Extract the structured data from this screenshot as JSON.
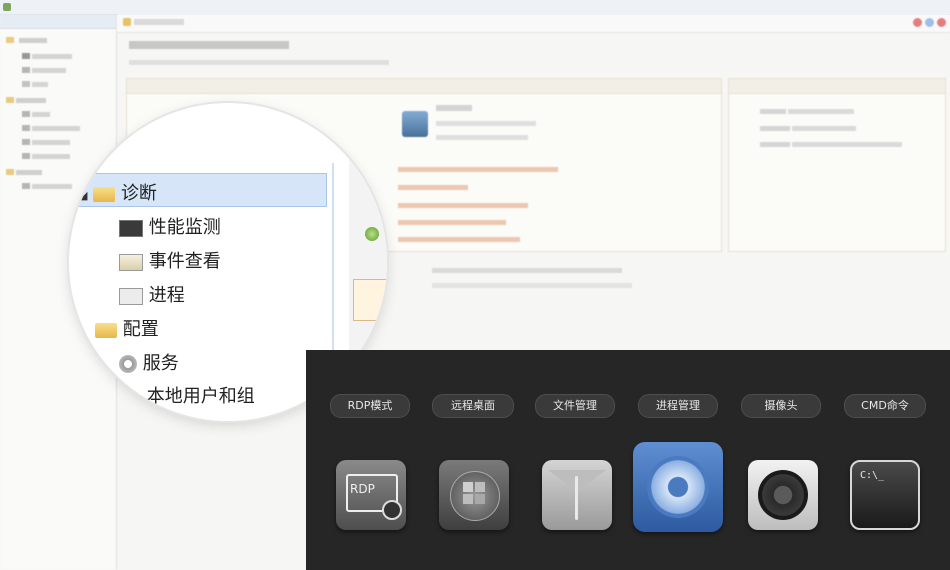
{
  "window": {
    "title": ""
  },
  "sidebar": {
    "header": "",
    "items": [
      {
        "label": "",
        "level": 0
      },
      {
        "label": "",
        "level": 1
      },
      {
        "label": "",
        "level": 1
      },
      {
        "label": "",
        "level": 1
      },
      {
        "label": "",
        "level": 0
      },
      {
        "label": "",
        "level": 1
      },
      {
        "label": "",
        "level": 1
      },
      {
        "label": "",
        "level": 1
      },
      {
        "label": "",
        "level": 1
      },
      {
        "label": "",
        "level": 0
      },
      {
        "label": "",
        "level": 1
      }
    ]
  },
  "main": {
    "tab_label": "",
    "headline": "",
    "subline": "",
    "left_panel_title": "",
    "right_panel_title": "",
    "device_name": "",
    "links": [
      "",
      "",
      "",
      "",
      ""
    ],
    "footer_line1": "",
    "footer_line2": ""
  },
  "magnifier_tree": {
    "group1": "诊断",
    "group1_children": [
      "性能监测",
      "事件查看",
      "进程"
    ],
    "group2": "配置",
    "group2_children": [
      "服务",
      "本地用户和组"
    ]
  },
  "toolbar": {
    "buttons": [
      "RDP模式",
      "远程桌面",
      "文件管理",
      "进程管理",
      "摄像头",
      "CMD命令"
    ],
    "icons": [
      "rdp-icon",
      "windows-icon",
      "file-envelope-icon",
      "gear-icon",
      "camera-icon",
      "terminal-icon"
    ],
    "rdp_text": "RDP",
    "cmd_text": "C:\\_"
  },
  "colors": {
    "accent_blue": "#4a7ac0",
    "link_orange": "#d88a5f",
    "toolbar_bg": "#262626"
  }
}
